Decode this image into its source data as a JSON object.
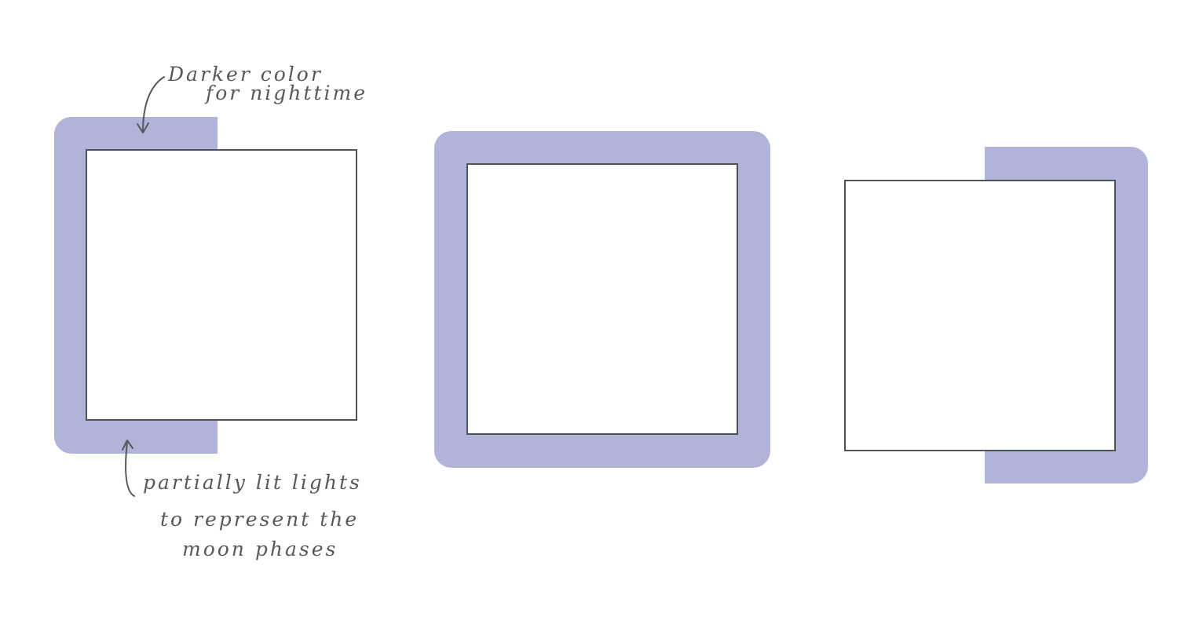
{
  "colors": {
    "light_glow": "#b1b4d9",
    "frame_stroke": "#4f5256",
    "annotation_ink": "#55585c",
    "background": "#ffffff"
  },
  "annotations": {
    "night_color": {
      "line1": "Darker color",
      "line2": "for nighttime"
    },
    "moon_phases": {
      "line1": "partially lit lights",
      "line2": "to represent the",
      "line3": "moon phases"
    }
  },
  "panels": [
    {
      "id": "left",
      "glow": "left half lit"
    },
    {
      "id": "center",
      "glow": "fully lit"
    },
    {
      "id": "right",
      "glow": "right half lit"
    }
  ]
}
